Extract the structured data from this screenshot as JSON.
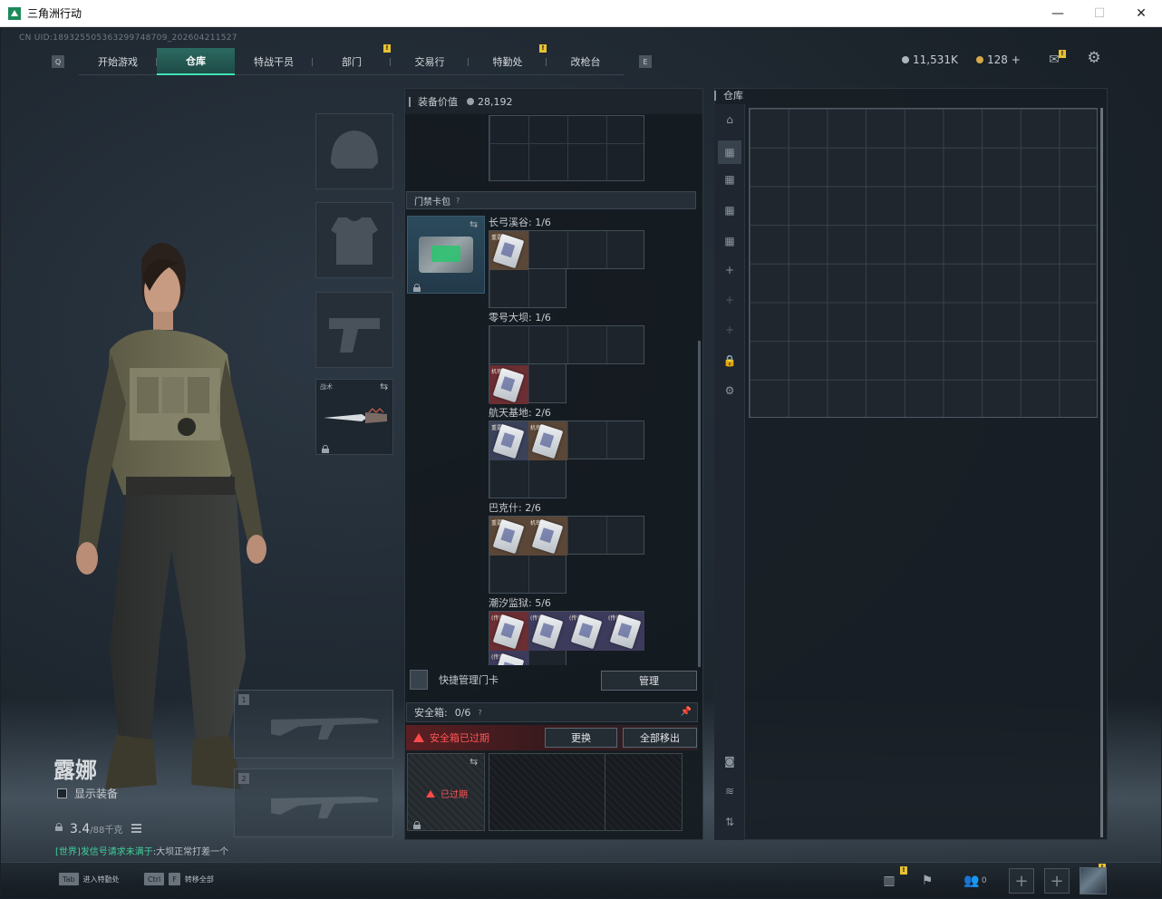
{
  "window": {
    "title": "三角洲行动",
    "minimize": "—",
    "maximize": "☐",
    "close": "✕"
  },
  "uid": "CN UID:1893255053632997487​09_202604211527",
  "nav": {
    "key_left": "Q",
    "key_right": "E",
    "tabs": [
      {
        "label": "开始游戏",
        "active": false,
        "badge": ""
      },
      {
        "label": "仓库",
        "active": true,
        "badge": ""
      },
      {
        "label": "特战干员",
        "active": false,
        "badge": ""
      },
      {
        "label": "部门",
        "active": false,
        "badge": "!"
      },
      {
        "label": "交易行",
        "active": false,
        "badge": ""
      },
      {
        "label": "特勤处",
        "active": false,
        "badge": "!"
      },
      {
        "label": "改枪台",
        "active": false,
        "badge": ""
      }
    ]
  },
  "currency": {
    "silver": "11,531K",
    "gold": "128 +",
    "silver_color": "#aeb6bd",
    "gold_color": "#d7a948"
  },
  "top_icons": {
    "mail": "mail-icon",
    "settings": "gear-icon",
    "mail_badge": "!"
  },
  "character": {
    "name": "露娜",
    "show_equipment": "显示装备",
    "weight": "3.4",
    "weight_max": "/88千克"
  },
  "equipment": {
    "knife_label": "战术"
  },
  "weapons": [
    {
      "num": "1"
    },
    {
      "num": "2"
    }
  ],
  "chat": {
    "channel": "[世界]",
    "sender": "发信号请求未满于",
    "text": ":大坝正常打差一个"
  },
  "bottom": {
    "hint1_key": "Tab",
    "hint1_label": "进入特勤处",
    "hint2_key1": "Ctrl",
    "hint2_key2": "F",
    "hint2_label": "转移全部",
    "friends_count": "0",
    "badge": "!"
  },
  "middle": {
    "equip_value_label": "装备价值",
    "equip_value": "28,192",
    "keycard_section": "门禁卡包",
    "keycard_help": "?",
    "maps": [
      {
        "name": "长弓溪谷: 1/6"
      },
      {
        "name": "零号大坝: 1/6"
      },
      {
        "name": "航天基地: 2/6"
      },
      {
        "name": "巴克什: 2/6"
      },
      {
        "name": "潮汐监狱: 5/6"
      }
    ],
    "card_tags": {
      "a": "重要",
      "b": "机密",
      "c": "(传说)"
    },
    "quick_manage": "快捷管理门卡",
    "manage_btn": "管理",
    "safe_label": "安全箱:",
    "safe_count": "0/6",
    "safe_help": "?",
    "safe_expired_warning": "安全箱已过期",
    "replace_btn": "更换",
    "move_all_btn": "全部移出",
    "expired": "已过期"
  },
  "right": {
    "label": "仓库"
  }
}
